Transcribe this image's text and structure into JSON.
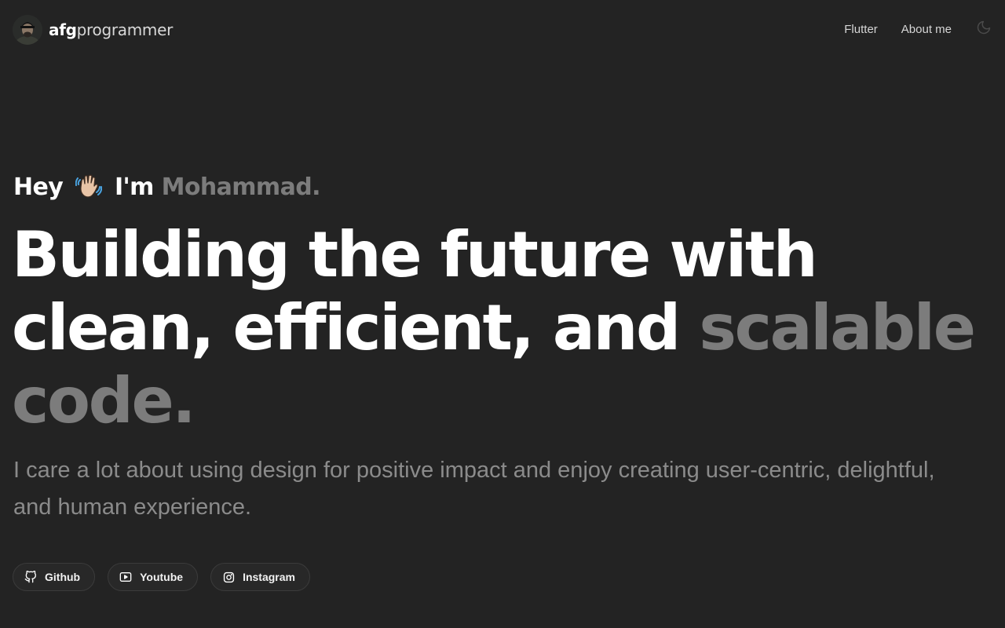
{
  "header": {
    "brand_bold": "afg",
    "brand_light": "programmer",
    "nav": {
      "flutter": "Flutter",
      "about": "About me"
    },
    "theme_icon": "moon-icon"
  },
  "hero": {
    "greeting_hey": "Hey",
    "greeting_im": "I'm",
    "greeting_name": "Mohammad.",
    "wave_icon": "waving-hand-icon",
    "headline_line1": "Building the future with",
    "headline_line2_main": "clean, efficient, and",
    "headline_line2_muted": "scalable",
    "headline_line3_muted": "code.",
    "subtitle": "I care a lot about using design for positive impact and enjoy creating user-centric, delightful, and human experience."
  },
  "socials": [
    {
      "label": "Github",
      "icon": "github-icon"
    },
    {
      "label": "Youtube",
      "icon": "youtube-icon"
    },
    {
      "label": "Instagram",
      "icon": "instagram-icon"
    }
  ],
  "colors": {
    "background": "#232323",
    "text": "#ffffff",
    "muted": "#7c7c7c",
    "subtitle": "#8b8b8b"
  }
}
